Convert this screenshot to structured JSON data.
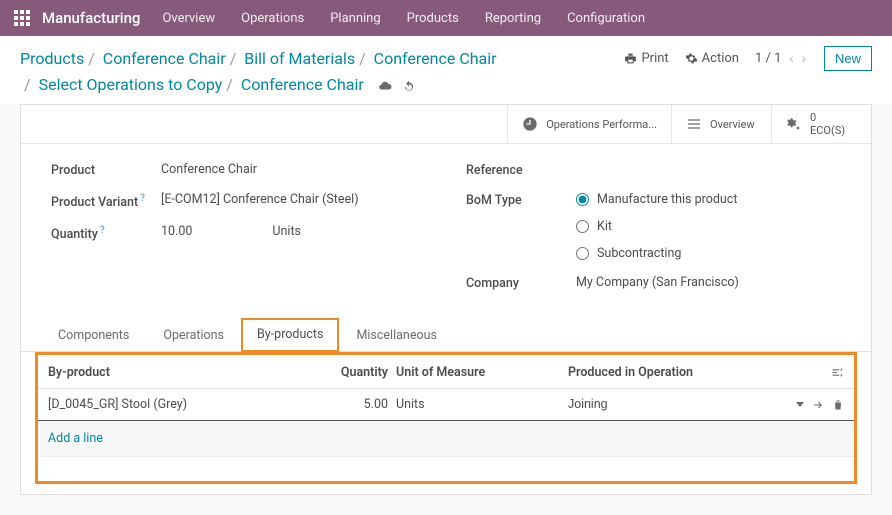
{
  "topnav": {
    "brand": "Manufacturing",
    "items": [
      "Overview",
      "Operations",
      "Planning",
      "Products",
      "Reporting",
      "Configuration"
    ]
  },
  "breadcrumb": {
    "parts": [
      "Products",
      "Conference Chair",
      "Bill of Materials",
      "Conference Chair",
      "Select Operations to Copy",
      "Conference Chair"
    ],
    "print": "Print",
    "action": "Action",
    "pager": "1 / 1",
    "new": "New"
  },
  "stat_buttons": {
    "ops_perf": "Operations Performa...",
    "overview": "Overview",
    "eco_count": "0",
    "eco_label": "ECO(S)"
  },
  "form": {
    "left": {
      "product_label": "Product",
      "product_value": "Conference Chair",
      "variant_label": "Product Variant",
      "variant_value": "[E-COM12] Conference Chair (Steel)",
      "qty_label": "Quantity",
      "qty_value": "10.00",
      "qty_uom": "Units"
    },
    "right": {
      "reference_label": "Reference",
      "bom_type_label": "BoM Type",
      "radio_options": [
        "Manufacture this product",
        "Kit",
        "Subcontracting"
      ],
      "radio_selected": 0,
      "company_label": "Company",
      "company_value": "My Company (San Francisco)"
    }
  },
  "tabs": {
    "items": [
      "Components",
      "Operations",
      "By-products",
      "Miscellaneous"
    ],
    "active_index": 2
  },
  "byproducts": {
    "headers": {
      "product": "By-product",
      "qty": "Quantity",
      "uom": "Unit of Measure",
      "operation": "Produced in Operation"
    },
    "rows": [
      {
        "product": "[D_0045_GR] Stool (Grey)",
        "qty": "5.00",
        "uom": "Units",
        "operation": "Joining"
      }
    ],
    "add_line": "Add a line"
  }
}
